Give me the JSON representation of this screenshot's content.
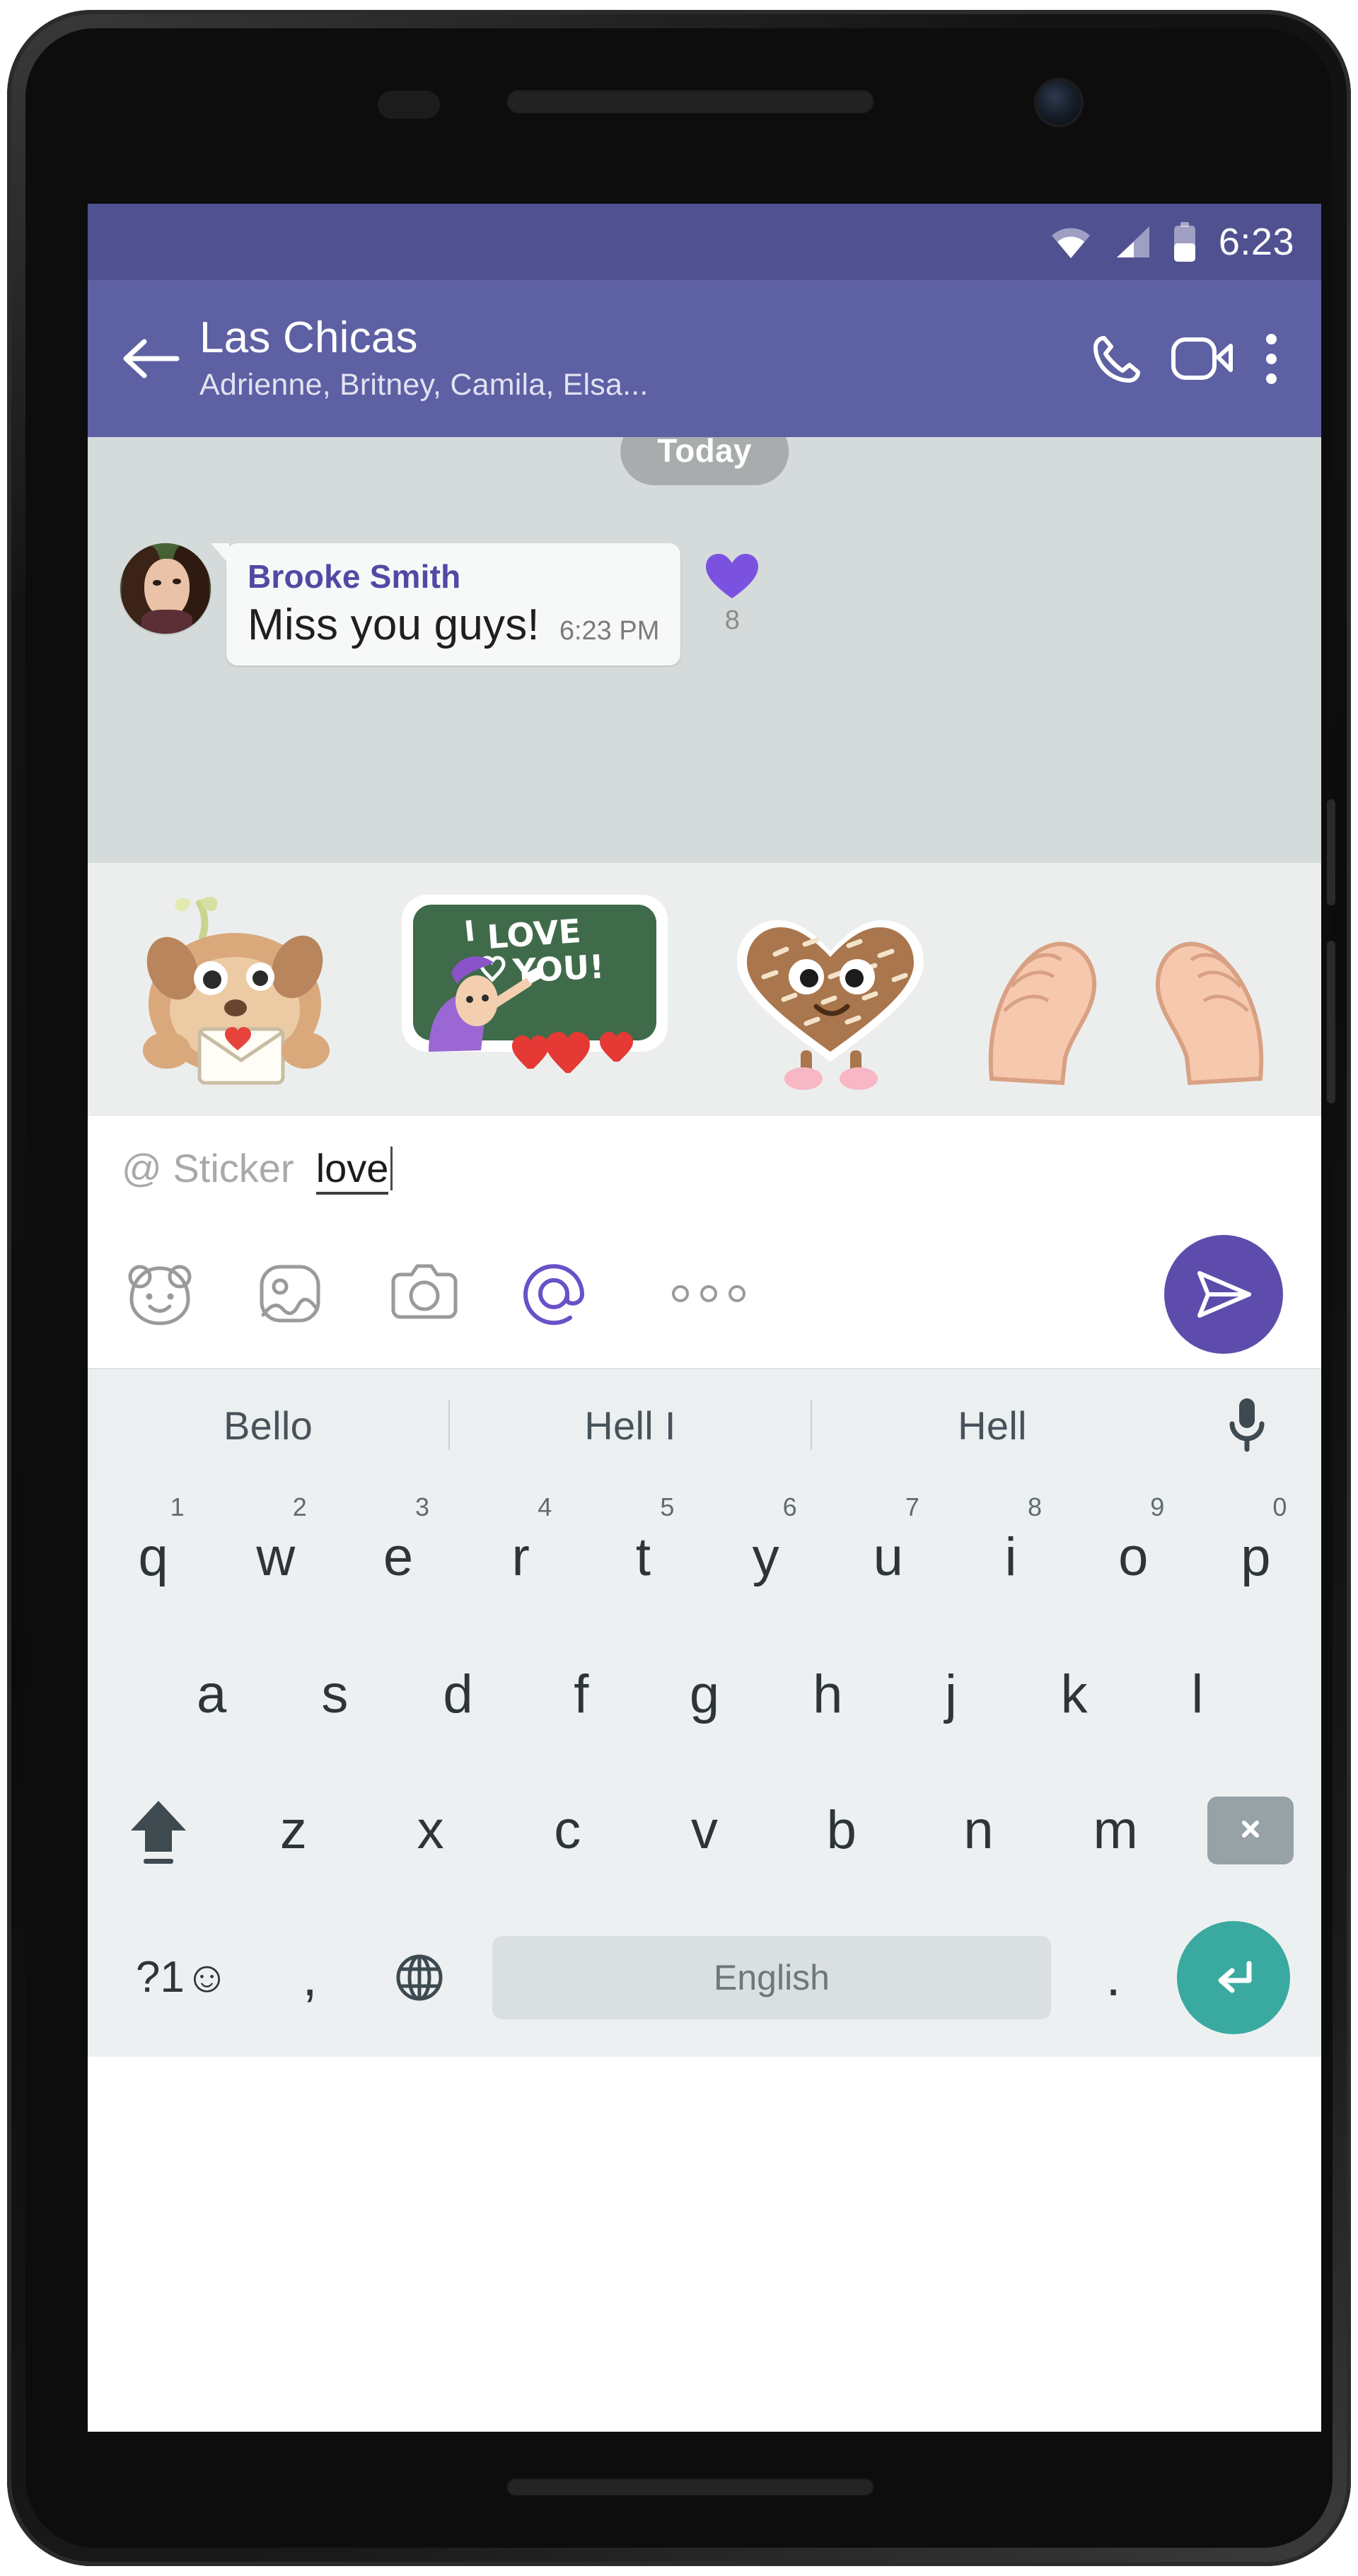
{
  "status_bar": {
    "time": "6:23",
    "icons": [
      "wifi-icon",
      "cellular-signal-icon",
      "battery-icon"
    ],
    "background": "#4F5191"
  },
  "app_bar": {
    "background": "#5D60A3",
    "back_label": "back-arrow-icon",
    "title": "Las Chicas",
    "subtitle": "Adrienne, Britney, Camila, Elsa...",
    "actions": [
      "phone-call-icon",
      "video-call-icon",
      "overflow-menu-icon"
    ]
  },
  "chat": {
    "background": "#D5DBDB",
    "date_chip": "Today",
    "message": {
      "sender": "Brooke Smith",
      "sender_color": "#5448A5",
      "text": "Miss you guys!",
      "time": "6:23 PM",
      "reaction_icon": "heart-icon",
      "reaction_color": "#7B52E0",
      "reaction_count": "8"
    }
  },
  "sticker_strip": {
    "background": "#ECEEEE",
    "stickers": [
      {
        "name": "sticker-dog-with-love-letter",
        "text": ""
      },
      {
        "name": "sticker-i-love-you-chalkboard",
        "text": "I LOVE YOU!"
      },
      {
        "name": "sticker-cookie-heart",
        "text": ""
      },
      {
        "name": "sticker-hands-heart",
        "text": ""
      }
    ]
  },
  "composer": {
    "hint": "@ Sticker",
    "value": "love",
    "tools": [
      {
        "name": "sticker-bear-icon",
        "active": false
      },
      {
        "name": "gallery-image-icon",
        "active": false
      },
      {
        "name": "camera-icon",
        "active": false
      },
      {
        "name": "at-mention-icon",
        "active": true
      },
      {
        "name": "more-options-icon",
        "active": false
      }
    ],
    "active_color": "#6951C8",
    "send_label": "send-icon",
    "send_color": "#5E4CAD"
  },
  "keyboard": {
    "background": "#EDF0F1",
    "suggestions": [
      "Bello",
      "Hell I",
      "Hell"
    ],
    "mic_icon": "microphone-icon",
    "row1": [
      {
        "key": "q",
        "num": "1"
      },
      {
        "key": "w",
        "num": "2"
      },
      {
        "key": "e",
        "num": "3"
      },
      {
        "key": "r",
        "num": "4"
      },
      {
        "key": "t",
        "num": "5"
      },
      {
        "key": "y",
        "num": "6"
      },
      {
        "key": "u",
        "num": "7"
      },
      {
        "key": "i",
        "num": "8"
      },
      {
        "key": "o",
        "num": "9"
      },
      {
        "key": "p",
        "num": "0"
      }
    ],
    "row2": [
      "a",
      "s",
      "d",
      "f",
      "g",
      "h",
      "j",
      "k",
      "l"
    ],
    "row3": [
      "z",
      "x",
      "c",
      "v",
      "b",
      "n",
      "m"
    ],
    "shift_icon": "shift-arrow-icon",
    "backspace_icon": "backspace-icon",
    "symbols_key": "?1☺",
    "comma_key": ",",
    "globe_icon": "globe-language-icon",
    "space_label": "English",
    "period_key": ".",
    "enter_icon": "enter-return-icon",
    "enter_color": "#3AA9A0"
  }
}
